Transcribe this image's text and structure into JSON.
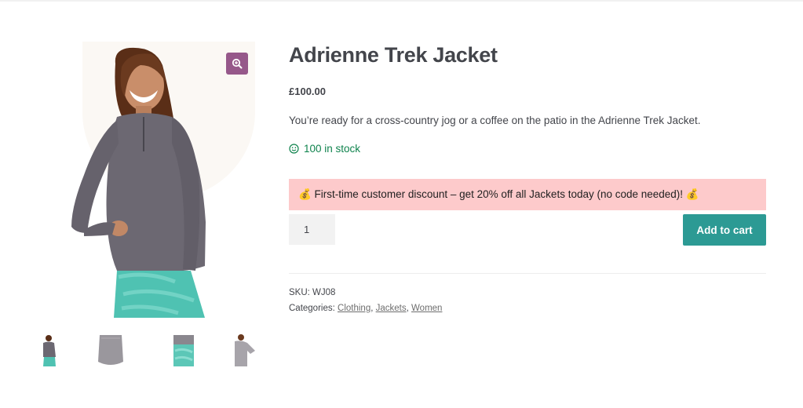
{
  "product": {
    "title": "Adrienne Trek Jacket",
    "price": "£100.00",
    "description": "You’re ready for a cross-country jog or a coffee on the patio in the Adrienne Trek Jacket.",
    "stock": "100 in stock",
    "notice": "💰 First-time customer discount – get 20% off all Jackets today (no code needed)! 💰",
    "quantity": "1",
    "add_to_cart_label": "Add to cart",
    "sku_label": "SKU:",
    "sku_value": "WJ08",
    "categories_label": "Categories:",
    "categories": [
      "Clothing",
      "Jackets",
      "Women"
    ],
    "separator": ","
  },
  "gallery": {
    "main_image_icon": "model-photo-jacket",
    "zoom_icon": "zoom-icon",
    "thumbnails": [
      "model-front",
      "jacket-back",
      "leggings-detail",
      "model-side"
    ]
  },
  "colors": {
    "accent_purple": "#96588a",
    "button_teal": "#2c9a94",
    "stock_green": "#0f834d",
    "notice_pink": "#fdcacb"
  }
}
